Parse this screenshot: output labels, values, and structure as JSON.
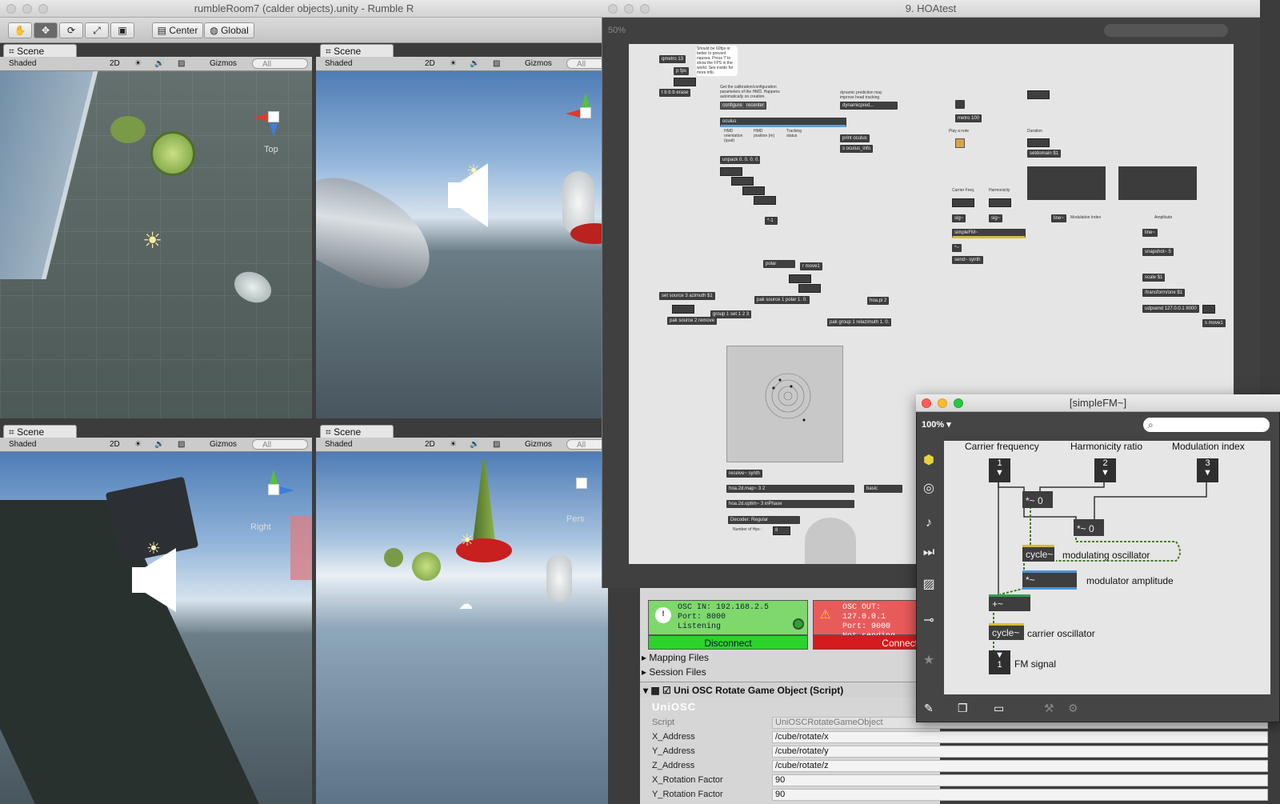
{
  "unity": {
    "window_title": "rumbleRoom7 (calder objects).unity - Rumble R",
    "toolbar": {
      "pivot_label": "Center",
      "space_label": "Global"
    },
    "views": [
      {
        "tab": "Scene",
        "shading": "Shaded",
        "mode2d": "2D",
        "gizmos": "Gizmos",
        "search_placeholder": "All",
        "axis_label": "Top"
      },
      {
        "tab": "Scene",
        "shading": "Shaded",
        "mode2d": "2D",
        "gizmos": "Gizmos",
        "search_placeholder": "All",
        "axis_label": ""
      },
      {
        "tab": "Scene",
        "shading": "Shaded",
        "mode2d": "2D",
        "gizmos": "Gizmos",
        "search_placeholder": "All",
        "axis_label": "Right"
      },
      {
        "tab": "Scene",
        "shading": "Shaded",
        "mode2d": "2D",
        "gizmos": "Gizmos",
        "search_placeholder": "All",
        "axis_label": "Pers"
      }
    ]
  },
  "max": {
    "window_title": "9. HOAtest",
    "zoom": "50%",
    "objects": {
      "qmetro": "qmetro 13",
      "pfps": "p fps",
      "tbbb": "t b b b erase",
      "configure": "configure",
      "recenter": "recenter",
      "dynamicpred": "dynamicpred...",
      "oculus": "oculus",
      "print_oculus": "print oculus",
      "s_oculus_info": "s oculus_info",
      "unpack": "unpack 0. 0. 0. 0.",
      "metro": "metro 100",
      "setdomain": "setdomain $1",
      "polar": "polar",
      "r_move1": "r move1",
      "set_source": "set source 3 azimuth $1",
      "pak_source_polar": "pak source 1 polar 1. 0.",
      "hoa_pi": "hoa.pi 2",
      "pak_source_remove": "pak source 2 remove",
      "group": "group 1 set 1 2 3",
      "pak_group": "pak group 1 relazimuth 1. 0.",
      "simplefm": "simpleFM~",
      "send_synth": "send~ synth",
      "line_a": "line~",
      "line_b": "line~",
      "snapshot": "snapshot~ 5",
      "scale": "scale $1",
      "transform": "/transform/one $1",
      "udpsend": "udpsend 127.0.0.1 8000",
      "s_move1": "s move1",
      "receive_synth": "receive~ synth",
      "hoa_map": "hoa.2d.map~ 3 2",
      "hoa_optim": "hoa.2d.optim~ 3 inPhase",
      "basic": "basic",
      "decoder": "Decoder: Regular",
      "num_hps": "8"
    },
    "comments": {
      "fps_note": "Should be 60fps or better to prevent nausea. Press 'f' to show the FPS in the world. See inside for more info.",
      "calib_note": "Get the calibration/configuration parameters of the HMD. Happens automatically on creation.",
      "dynpred_note": "dynamic prediction may improve head tracking",
      "hmd_orientation": "HMD orientation (quat)",
      "hmd_position": "HMD position (m)",
      "tracking_status": "Tracking status",
      "play_note": "Play a note",
      "duration": "Duration",
      "carrier_freq": "Carrier Freq.",
      "harmonicity": "Harmonicity",
      "mod_index": "Modulation Index",
      "amplitude": "Amplitude",
      "num_hps_label": "Number of Hps :"
    }
  },
  "osc": {
    "in_text": "OSC IN: 192.168.2.5",
    "in_port": "Port: 8000",
    "in_status": "Listening",
    "disconnect_label": "Disconnect",
    "out_text": "OSC OUT: 127.0.0.1",
    "out_port": "Port: 9000",
    "out_status": "Not sending",
    "connect_label": "Connect",
    "mapping_files": "Mapping Files",
    "session_files": "Session Files",
    "component_title": "Uni OSC Rotate Game Object (Script)",
    "logo": "UniOSC",
    "fields": [
      {
        "label": "Script",
        "value": "UniOSCRotateGameObject"
      },
      {
        "label": "X_Address",
        "value": "/cube/rotate/x"
      },
      {
        "label": "Y_Address",
        "value": "/cube/rotate/y"
      },
      {
        "label": "Z_Address",
        "value": "/cube/rotate/z"
      },
      {
        "label": "X_Rotation Factor",
        "value": "90"
      },
      {
        "label": "Y_Rotation Factor",
        "value": "90"
      }
    ]
  },
  "simplefm": {
    "window_title": "[simpleFM~]",
    "zoom": "100%",
    "labels": {
      "carrier": "Carrier frequency",
      "harmonicity": "Harmonicity ratio",
      "modindex": "Modulation index",
      "modulating": "modulating oscillator",
      "mod_amp": "modulator amplitude",
      "carrier_osc": "carrier oscillator",
      "fm_signal": "FM signal"
    },
    "objects": {
      "mul1": "*~ 0",
      "mul2": "*~ 0",
      "cycle1": "cycle~",
      "mulamp": "*~",
      "plus": "+~",
      "cycle2": "cycle~"
    },
    "inlets": {
      "in1": "1",
      "in2": "2",
      "in3": "3",
      "out1": "1"
    }
  }
}
